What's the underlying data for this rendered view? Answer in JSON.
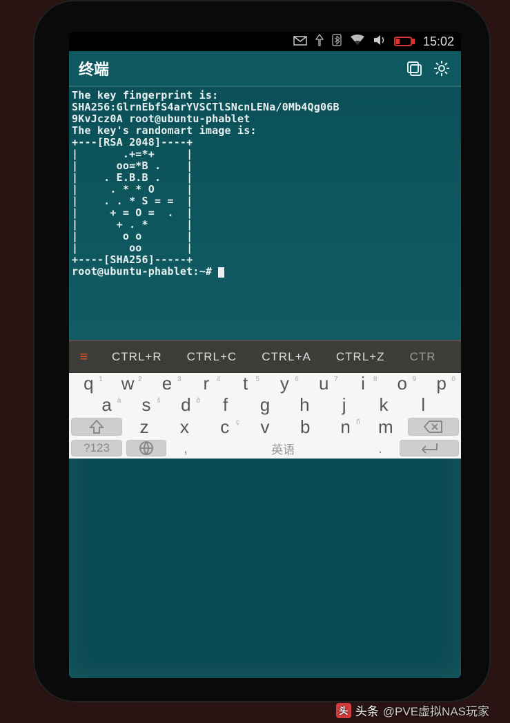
{
  "status": {
    "time": "15:02"
  },
  "appbar": {
    "title": "终端"
  },
  "terminal": {
    "lines": [
      "The key fingerprint is:",
      "SHA256:GlrnEbfS4arYVSCTlSNcnLENa/0Mb4Qg06B",
      "9KvJcz0A root@ubuntu-phablet",
      "The key's randomart image is:",
      "+---[RSA 2048]----+",
      "|       .+=*+     |",
      "|      oo=*B .    |",
      "|    . E.B.B .    |",
      "|     . * * O     |",
      "|    . . * S = =  |",
      "|     + = O =  .  |",
      "|      + . *      |",
      "|       o o       |",
      "|        oo       |",
      "+----[SHA256]-----+"
    ],
    "prompt": "root@ubuntu-phablet:~# "
  },
  "shortcuts": {
    "items": [
      "CTRL+R",
      "CTRL+C",
      "CTRL+A",
      "CTRL+Z",
      "CTR"
    ]
  },
  "keyboard": {
    "row1": [
      {
        "k": "q",
        "h": "1"
      },
      {
        "k": "w",
        "h": "2"
      },
      {
        "k": "e",
        "h": "3"
      },
      {
        "k": "r",
        "h": "4"
      },
      {
        "k": "t",
        "h": "5"
      },
      {
        "k": "y",
        "h": "6"
      },
      {
        "k": "u",
        "h": "7"
      },
      {
        "k": "i",
        "h": "8"
      },
      {
        "k": "o",
        "h": "9"
      },
      {
        "k": "p",
        "h": "0"
      }
    ],
    "row2": [
      {
        "k": "a",
        "h": "à"
      },
      {
        "k": "s",
        "h": "š"
      },
      {
        "k": "d",
        "h": "ð"
      },
      {
        "k": "f",
        "h": ""
      },
      {
        "k": "g",
        "h": ""
      },
      {
        "k": "h",
        "h": ""
      },
      {
        "k": "j",
        "h": ""
      },
      {
        "k": "k",
        "h": ""
      },
      {
        "k": "l",
        "h": ""
      }
    ],
    "row3": [
      {
        "k": "z",
        "h": ""
      },
      {
        "k": "x",
        "h": ""
      },
      {
        "k": "c",
        "h": "ç"
      },
      {
        "k": "v",
        "h": ""
      },
      {
        "k": "b",
        "h": ""
      },
      {
        "k": "n",
        "h": "ñ"
      },
      {
        "k": "m",
        "h": ""
      }
    ],
    "row4": {
      "sym": "?123",
      "comma": ",",
      "space": "英语",
      "dot": "."
    }
  },
  "watermark": {
    "prefix": "头条",
    "handle": "@PVE虚拟NAS玩家"
  }
}
